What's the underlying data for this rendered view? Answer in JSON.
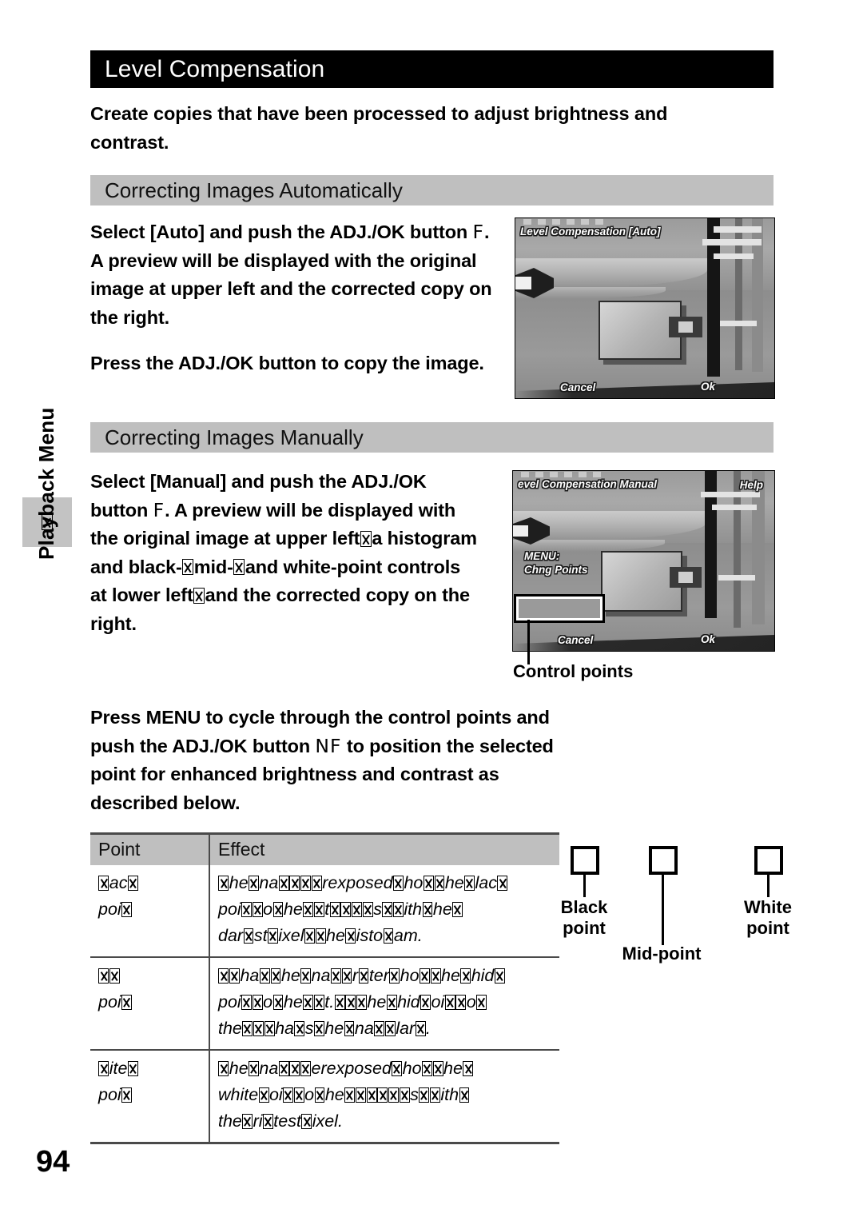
{
  "page": {
    "title": "Level Compensation",
    "number": "94",
    "intro": "Create copies that have been processed to adjust brightness and contrast."
  },
  "sidebar": {
    "tab_label": "Playback Menu",
    "tab_icon": "missing-glyph-box"
  },
  "sections": [
    {
      "id": "auto",
      "heading": "Correcting Images Automatically",
      "paragraph_1_pre": "Select [Auto] and push the ADJ./OK button ",
      "paragraph_1_glyph": "F",
      "paragraph_1_post": ". A preview will be displayed with the original image at upper left and the corrected copy on the right.",
      "paragraph_2": "Press the ADJ./OK button to copy the image."
    },
    {
      "id": "manual",
      "heading": "Correcting Images Manually",
      "paragraph_1_pre": "Select [Manual] and push the ADJ./OK button ",
      "paragraph_1_glyph": "F",
      "paragraph_1_post_a": ". A preview will be displayed with the original image at upper left",
      "paragraph_1_post_b": "a histogram and black-",
      "paragraph_1_post_c": "mid-",
      "paragraph_1_post_d": "and white-point controls at lower left",
      "paragraph_1_post_e": "and the corrected copy on the right.",
      "paragraph_2_pre": "Press MENU to cycle through the control points and push the ADJ./OK button ",
      "paragraph_2_glyph": "NF",
      "paragraph_2_post": " to position the selected point for enhanced brightness and contrast as described below."
    }
  ],
  "lcd_auto": {
    "title": "Level Compensation [Auto]",
    "cancel": "Cancel",
    "ok": "Ok"
  },
  "lcd_manual": {
    "title_pre": "evel Compensation ",
    "title_mode": "Manual",
    "help": "Help",
    "menu_line1": "MENU:",
    "menu_line2": "Chng Points",
    "cancel": "Cancel",
    "ok": "Ok",
    "callout_caption": "Control points"
  },
  "table": {
    "headers": [
      "Point",
      "Effect"
    ],
    "rows": [
      {
        "point_line1_pre": "",
        "point_line1": "ac",
        "point_line2": "poi",
        "effect_line1": "he na          exposed  o  he  lac",
        "effect_line2": "poi   o  he    t.        s    ith  he",
        "effect_line3": "dar st ixel    he  isto  am."
      },
      {
        "point_line1": "",
        "point_line2": "poi",
        "effect_line1": "   ha  he  na   r  ter  ho  he  hid",
        "effect_line2": "poi    o  he    t.     he  hid  oi    o",
        "effect_line3": "the      ha s  he  na    lar ."
      },
      {
        "point_line1": "ite",
        "point_line2": "poi",
        "effect_line1": "he  na        erexposed  ho   he",
        "effect_line2": "white oi    o  he                s    ith",
        "effect_line3": "the  ri  test  ixel."
      }
    ]
  },
  "diagram": {
    "labels": [
      "Black\npoint",
      "Mid-point",
      "White\npoint"
    ]
  }
}
